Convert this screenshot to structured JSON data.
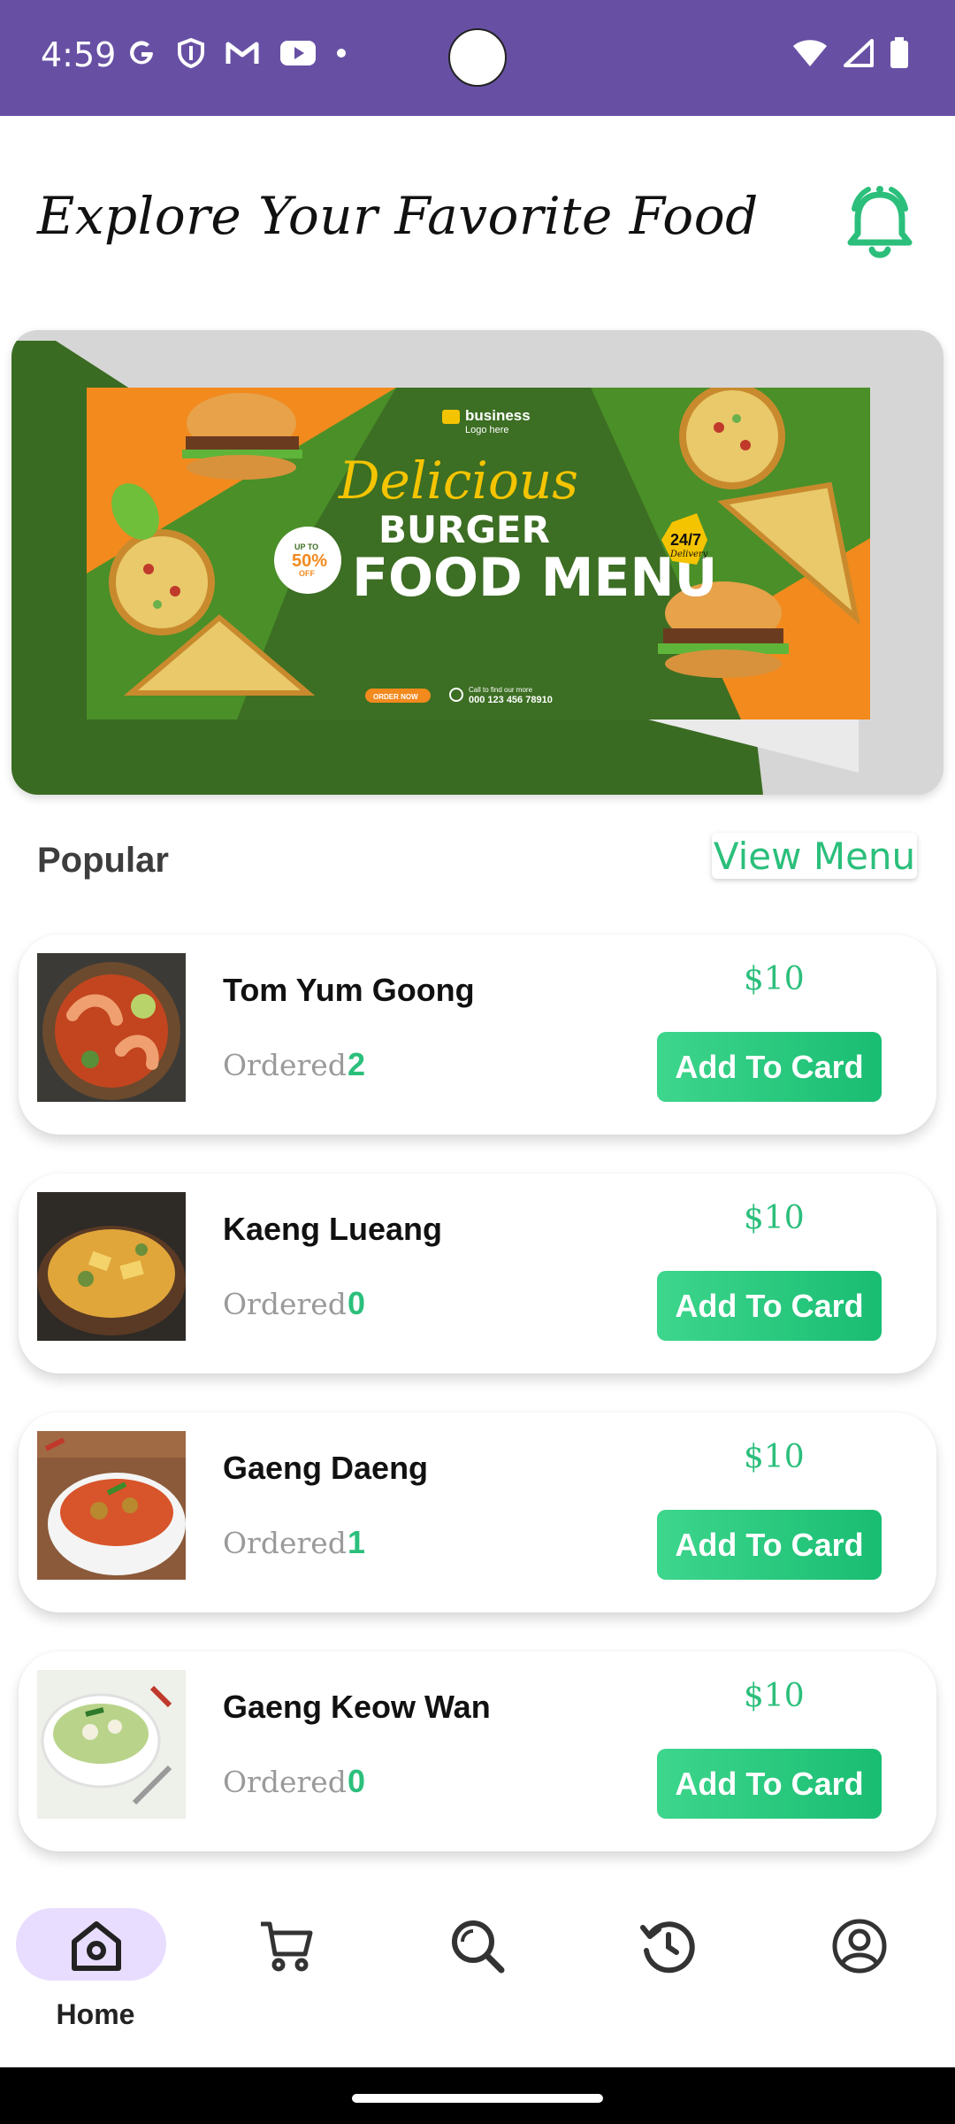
{
  "status_bar": {
    "time": "4:59",
    "left_icons": [
      "google-icon",
      "shield-icon",
      "gmail-icon",
      "youtube-icon",
      "dot-icon"
    ],
    "right_icons": [
      "wifi-icon",
      "signal-icon",
      "battery-icon"
    ]
  },
  "header": {
    "title": "Explore Your Favorite Food",
    "notification_icon": "bell-icon",
    "accent": "#2bbf7b"
  },
  "banner": {
    "logo_text": "business",
    "logo_sub": "Logo here",
    "script_text": "Delicious",
    "line1": "BURGER",
    "line2": "FOOD MENU",
    "discount_top": "UP TO",
    "discount_value": "50%",
    "discount_bottom": "OFF",
    "badge_top": "24/7",
    "badge_bottom": "Delivery",
    "cta": "ORDER NOW",
    "call_text": "Call to find our more",
    "phone": "000 123 456 78910"
  },
  "popular": {
    "title": "Popular",
    "view_menu_label": "View Menu",
    "items": [
      {
        "name": "Tom Yum Goong",
        "ordered_label": "Ordered",
        "ordered": "2",
        "price": "$10",
        "button": "Add To Card"
      },
      {
        "name": "Kaeng Lueang",
        "ordered_label": "Ordered",
        "ordered": "0",
        "price": "$10",
        "button": "Add To Card"
      },
      {
        "name": "Gaeng Daeng",
        "ordered_label": "Ordered",
        "ordered": "1",
        "price": "$10",
        "button": "Add To Card"
      },
      {
        "name": "Gaeng Keow Wan",
        "ordered_label": "Ordered",
        "ordered": "0",
        "price": "$10",
        "button": "Add To Card"
      }
    ]
  },
  "bottom_nav": {
    "items": [
      {
        "label": "Home",
        "icon": "home-icon",
        "active": true
      },
      {
        "label": "",
        "icon": "cart-icon",
        "active": false
      },
      {
        "label": "",
        "icon": "search-icon",
        "active": false
      },
      {
        "label": "",
        "icon": "history-icon",
        "active": false
      },
      {
        "label": "",
        "icon": "profile-icon",
        "active": false
      }
    ]
  }
}
